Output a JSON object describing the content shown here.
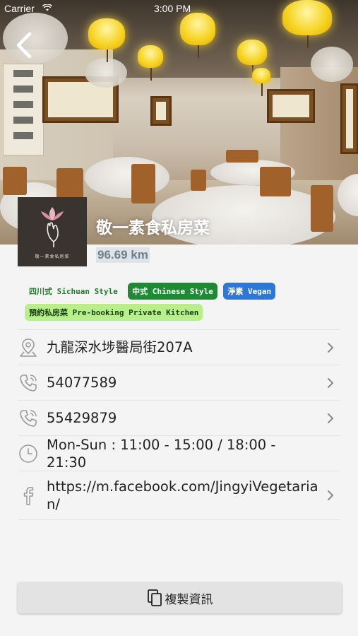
{
  "status_bar": {
    "carrier": "Carrier",
    "time": "3:00 PM"
  },
  "restaurant": {
    "name": "敬一素食私房菜",
    "distance": "96.69 km",
    "logo_caption": "敬一素食私房菜"
  },
  "tags": [
    {
      "label": "四川式 Sichuan Style",
      "style": "plain"
    },
    {
      "label": "中式 Chinese Style",
      "style": "green"
    },
    {
      "label": "淨素 Vegan",
      "style": "blue"
    },
    {
      "label": "預約私房菜 Pre-booking Private Kitchen",
      "style": "lightgreen"
    }
  ],
  "info": {
    "address": "九龍深水埗醫局街207A",
    "phone1": "54077589",
    "phone2": "55429879",
    "hours": "Mon-Sun : 11:00 - 15:00 / 18:00 - 21:30",
    "facebook": "https://m.facebook.com/JingyiVegetarian/"
  },
  "actions": {
    "copy_label": "複製資訊"
  },
  "icons": {
    "back": "chevron-left-icon",
    "address": "map-pin-icon",
    "phone": "phone-icon",
    "hours": "clock-icon",
    "facebook": "facebook-icon",
    "chevron": "chevron-right-icon",
    "copy": "copy-icon"
  },
  "colors": {
    "tag_green": "#1e8a34",
    "tag_blue": "#2d78d6",
    "tag_lightgreen": "#b7f08a",
    "tag_text_green": "#1e7f2a",
    "icon_gray": "#9a9a9a"
  }
}
